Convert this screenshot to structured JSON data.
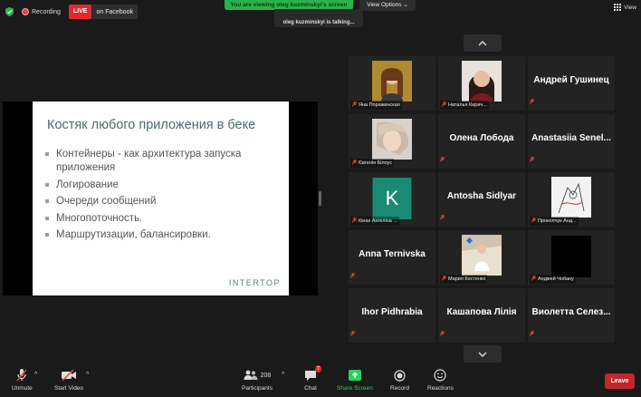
{
  "top_bar": {
    "recording_label": "Recording",
    "live_badge": "LIVE",
    "live_target": "on Facebook",
    "viewing_banner": "You are viewing oleg kuzminskyi's screen",
    "view_options_label": "View Options",
    "talking_label": "oleg kuzminskyi is talking...",
    "view_label": "View"
  },
  "slide": {
    "title": "Костяк любого приложения в беке",
    "bullets": [
      "Контейнеры - как архитектура запуска приложения",
      "Логирование",
      "Очереди сообщений",
      "Многопоточность.",
      "Маршрутизации, балансировки."
    ],
    "brand": "INTERTOP"
  },
  "gallery": {
    "tiles": [
      {
        "name": "Яна Поражинская",
        "kind": "photo"
      },
      {
        "name": "Наталья Кирич...",
        "kind": "photo"
      },
      {
        "name": "Андрей Гушинец",
        "kind": "text"
      },
      {
        "name": "Євгенія Білоус",
        "kind": "photo"
      },
      {
        "name": "Олена Лобода",
        "kind": "text"
      },
      {
        "name": "Anastasiia  Senel...",
        "kind": "text"
      },
      {
        "name": "Кінах Ангеліна ...",
        "kind": "avatar",
        "avatar_letter": "K"
      },
      {
        "name": "Antosha Sidlyar",
        "kind": "text"
      },
      {
        "name": "Прокопчук Анд...",
        "kind": "photo"
      },
      {
        "name": "Anna Ternivska",
        "kind": "text"
      },
      {
        "name": "Мария Костенко",
        "kind": "photo"
      },
      {
        "name": "Анджей Чобану",
        "kind": "video-off"
      },
      {
        "name": "Ihor Pidhrabia",
        "kind": "text"
      },
      {
        "name": "Кашапова Лілія",
        "kind": "text"
      },
      {
        "name": "Виолетта  Селез...",
        "kind": "text"
      }
    ]
  },
  "toolbar": {
    "unmute_label": "Unmute",
    "start_video_label": "Start Video",
    "participants_count": "208",
    "participants_label": "Participants",
    "chat_badge": "7",
    "chat_label": "Chat",
    "share_label": "Share Screen",
    "record_label": "Record",
    "reactions_label": "Reactions",
    "leave_label": "Leave"
  },
  "colors": {
    "live_red": "#e0282e",
    "banner_green": "#2bb24c",
    "share_green": "#2bd161",
    "leave_red": "#c1272d",
    "muted_red": "#e0463c"
  }
}
